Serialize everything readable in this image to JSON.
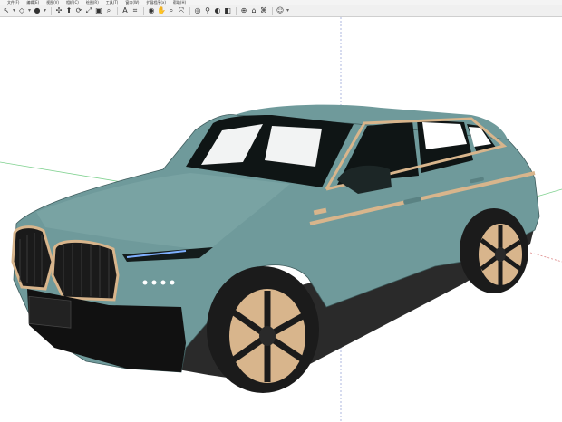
{
  "menubar": {
    "items": [
      "文件(F)",
      "编辑(E)",
      "视图(V)",
      "相机(C)",
      "绘图(R)",
      "工具(T)",
      "窗口(W)",
      "扩展程序(x)",
      "帮助(H)"
    ]
  },
  "toolbar": {
    "tools": [
      {
        "name": "select-tool",
        "icon": "select-icon",
        "glyph": "↖"
      },
      {
        "name": "select-dropdown",
        "icon": "chevron-down-icon",
        "glyph": "▾"
      },
      {
        "name": "eraser-tool",
        "icon": "eraser-icon",
        "glyph": "◇"
      },
      {
        "name": "eraser-dropdown",
        "icon": "chevron-down-icon",
        "glyph": "▾"
      },
      {
        "name": "paint-tool",
        "icon": "paint-bucket-icon",
        "glyph": "●"
      },
      {
        "name": "paint-dropdown",
        "icon": "chevron-down-icon",
        "glyph": "▾"
      },
      {
        "name": "move-tool",
        "icon": "move-icon",
        "glyph": "✣"
      },
      {
        "name": "push-pull-tool",
        "icon": "push-pull-icon",
        "glyph": "⬆"
      },
      {
        "name": "rotate-tool",
        "icon": "rotate-icon",
        "glyph": "⟳"
      },
      {
        "name": "scale-tool",
        "icon": "scale-icon",
        "glyph": "⤢"
      },
      {
        "name": "offset-tool",
        "icon": "offset-icon",
        "glyph": "▣"
      },
      {
        "name": "tape-measure-tool",
        "icon": "tape-measure-icon",
        "glyph": "⌕"
      },
      {
        "name": "text-tool",
        "icon": "text-icon",
        "glyph": "A"
      },
      {
        "name": "dimension-tool",
        "icon": "dimension-icon",
        "glyph": "⌗"
      },
      {
        "name": "orbit-tool",
        "icon": "orbit-icon",
        "glyph": "◉"
      },
      {
        "name": "pan-tool",
        "icon": "pan-hand-icon",
        "glyph": "✋"
      },
      {
        "name": "zoom-tool",
        "icon": "zoom-icon",
        "glyph": "⌕"
      },
      {
        "name": "zoom-extents-tool",
        "icon": "zoom-extents-icon",
        "glyph": "⤧"
      },
      {
        "name": "position-camera-tool",
        "icon": "camera-icon",
        "glyph": "◎"
      },
      {
        "name": "walk-tool",
        "icon": "walk-icon",
        "glyph": "⚲"
      },
      {
        "name": "look-around-tool",
        "icon": "eye-icon",
        "glyph": "◐"
      },
      {
        "name": "section-plane-tool",
        "icon": "section-plane-icon",
        "glyph": "◧"
      },
      {
        "name": "geo-location-tool",
        "icon": "globe-icon",
        "glyph": "⊕"
      },
      {
        "name": "warehouse-tool",
        "icon": "warehouse-icon",
        "glyph": "⌂"
      },
      {
        "name": "extension-warehouse-tool",
        "icon": "extension-icon",
        "glyph": "⌘"
      },
      {
        "name": "account-button",
        "icon": "account-icon",
        "glyph": "☺"
      },
      {
        "name": "account-dropdown",
        "icon": "chevron-down-icon",
        "glyph": "▾"
      }
    ]
  },
  "colors": {
    "body_paint": "#6f9a9b",
    "trim": "#d8b58c",
    "glass": "#0f1515",
    "tire": "#1b1b1b",
    "axis_red": "#d24a4a",
    "axis_green": "#52b36a",
    "axis_blue": "#5a6fd6"
  }
}
